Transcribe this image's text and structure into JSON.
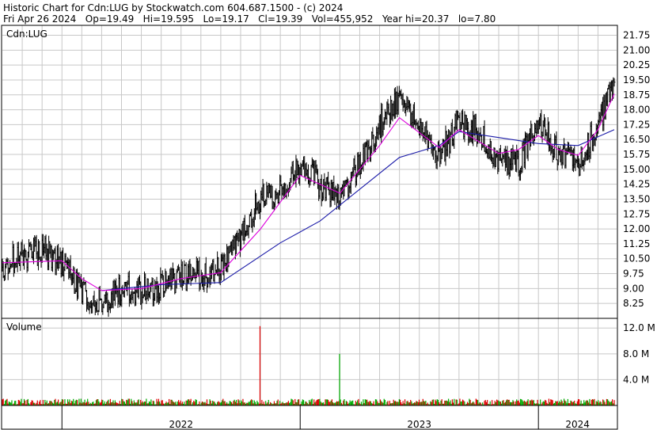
{
  "header": {
    "title": "Historic Chart for Cdn:LUG by Stockwatch.com 604.687.1500 - (c) 2024",
    "quote_line": "Fri Apr 26 2024   Op=19.49   Hi=19.595   Lo=19.17   Cl=19.39   Vol=455,952   Year hi=20.37   lo=7.80"
  },
  "price_panel": {
    "symbol_label": "Cdn:LUG"
  },
  "volume_panel": {
    "label": "Volume"
  },
  "colors": {
    "price_bar": "#000000",
    "ma_short": "#dd00dd",
    "ma_long": "#1a1aa8",
    "volume_up": "#00aa00",
    "volume_down": "#dd0000",
    "grid": "#c8c8c8"
  },
  "chart_data": [
    {
      "type": "ohlc",
      "title": "Historic Chart for Cdn:LUG",
      "x_range": [
        "2021-10",
        "2024-04"
      ],
      "x_year_labels": [
        "2022",
        "2023",
        "2024"
      ],
      "ylim": [
        7.5,
        22.25
      ],
      "y_ticks": [
        "21.75",
        "21.00",
        "20.25",
        "19.50",
        "18.75",
        "18.00",
        "17.25",
        "16.50",
        "15.75",
        "15.00",
        "14.25",
        "13.50",
        "12.75",
        "12.00",
        "11.25",
        "10.50",
        "9.75",
        "9.00",
        "8.25"
      ],
      "grid": true,
      "last_bar": {
        "date": "2024-04-26",
        "open": 19.49,
        "high": 19.595,
        "low": 19.17,
        "close": 19.39
      },
      "price_path": [
        [
          "2021-10",
          10.2
        ],
        [
          "2021-11",
          10.6
        ],
        [
          "2021-12",
          10.9
        ],
        [
          "2022-01",
          10.4
        ],
        [
          "2022-02",
          8.7
        ],
        [
          "2022-03",
          8.3
        ],
        [
          "2022-04",
          8.9
        ],
        [
          "2022-05",
          8.9
        ],
        [
          "2022-06",
          9.1
        ],
        [
          "2022-07",
          9.6
        ],
        [
          "2022-08",
          9.7
        ],
        [
          "2022-09",
          10.0
        ],
        [
          "2022-10",
          11.4
        ],
        [
          "2022-11",
          13.6
        ],
        [
          "2022-12",
          13.8
        ],
        [
          "2023-01",
          15.2
        ],
        [
          "2023-02",
          14.2
        ],
        [
          "2023-03",
          13.6
        ],
        [
          "2023-04",
          15.4
        ],
        [
          "2023-05",
          17.2
        ],
        [
          "2023-06",
          18.7
        ],
        [
          "2023-07",
          17.0
        ],
        [
          "2023-08",
          15.6
        ],
        [
          "2023-09",
          17.4
        ],
        [
          "2023-10",
          16.8
        ],
        [
          "2023-11",
          15.6
        ],
        [
          "2023-12",
          15.2
        ],
        [
          "2024-01",
          17.6
        ],
        [
          "2024-02",
          15.7
        ],
        [
          "2024-03",
          15.3
        ],
        [
          "2024-04",
          17.3
        ],
        [
          "2024-04-26",
          19.39
        ]
      ],
      "series": [
        {
          "name": "price",
          "style": "ohlc bars"
        },
        {
          "name": "",
          "style": "short moving average",
          "values": [
            [
              "2021-10",
              10.3
            ],
            [
              "2022-01",
              10.4
            ],
            [
              "2022-02",
              9.5
            ],
            [
              "2022-03",
              8.9
            ],
            [
              "2022-05",
              9.0
            ],
            [
              "2022-07",
              9.5
            ],
            [
              "2022-09",
              9.8
            ],
            [
              "2022-11",
              12.0
            ],
            [
              "2023-01",
              14.7
            ],
            [
              "2023-03",
              13.8
            ],
            [
              "2023-05",
              16.2
            ],
            [
              "2023-06",
              17.6
            ],
            [
              "2023-08",
              16.1
            ],
            [
              "2023-09",
              17.0
            ],
            [
              "2023-11",
              15.8
            ],
            [
              "2023-12",
              16.0
            ],
            [
              "2024-01",
              16.7
            ],
            [
              "2024-02",
              16.0
            ],
            [
              "2024-03",
              15.7
            ],
            [
              "2024-04",
              17.0
            ],
            [
              "2024-04-26",
              18.8
            ]
          ]
        },
        {
          "name": "",
          "style": "long moving average",
          "values": [
            [
              "2022-03",
              8.9
            ],
            [
              "2022-06",
              9.2
            ],
            [
              "2022-09",
              9.3
            ],
            [
              "2022-12",
              11.3
            ],
            [
              "2023-02",
              12.4
            ],
            [
              "2023-04",
              14.0
            ],
            [
              "2023-06",
              15.6
            ],
            [
              "2023-08",
              16.2
            ],
            [
              "2023-09",
              16.9
            ],
            [
              "2023-11",
              16.6
            ],
            [
              "2024-01",
              16.3
            ],
            [
              "2024-03",
              16.2
            ],
            [
              "2024-04-26",
              17.0
            ]
          ]
        }
      ]
    },
    {
      "type": "bar",
      "title": "Volume",
      "ylim": [
        0,
        13500000
      ],
      "y_ticks": [
        "12.0 M",
        "8.0 M",
        "4.0 M"
      ],
      "typical_daily_volume": 500000,
      "spikes": [
        {
          "date": "2022-11",
          "value": 12300000,
          "direction": "down"
        },
        {
          "date": "2023-03",
          "value": 8000000,
          "direction": "up"
        }
      ]
    }
  ]
}
